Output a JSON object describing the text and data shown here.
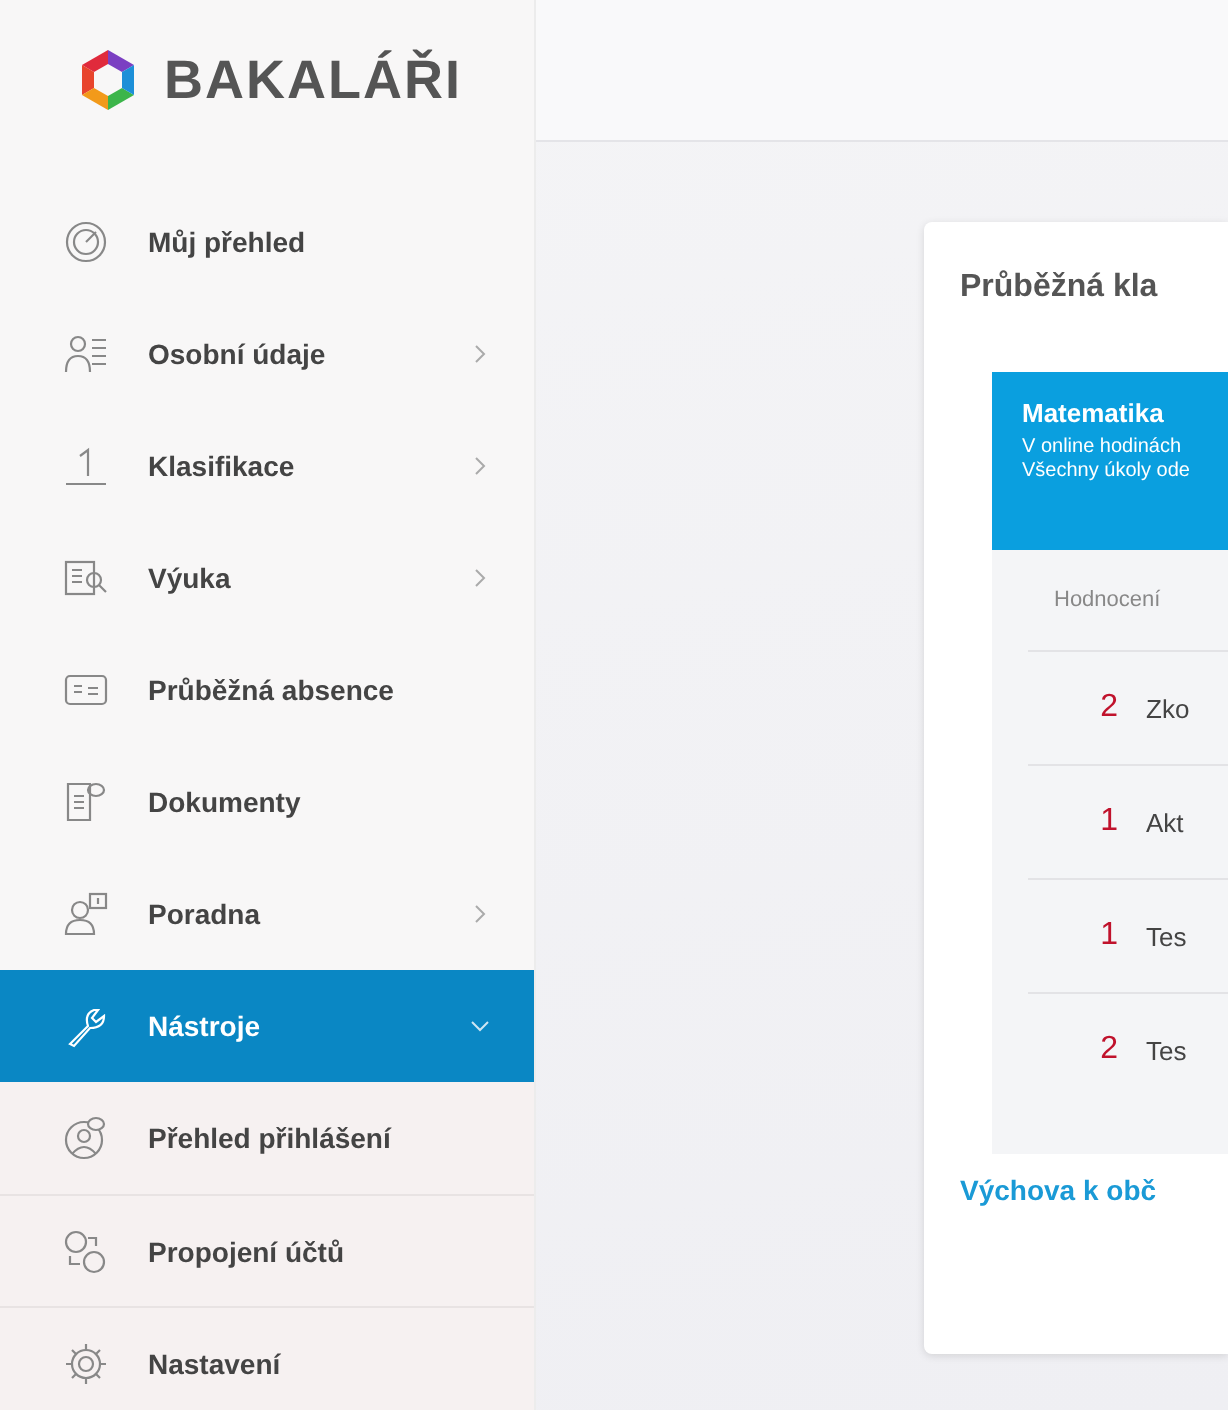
{
  "logo": {
    "text": "BAKALÁŘI"
  },
  "sidebar": {
    "items": [
      {
        "label": "Můj přehled",
        "kind": "link",
        "selected": false
      },
      {
        "label": "Osobní údaje",
        "kind": "group",
        "expanded": false,
        "selected": false
      },
      {
        "label": "Klasifikace",
        "kind": "group",
        "expanded": false,
        "selected": false
      },
      {
        "label": "Výuka",
        "kind": "group",
        "expanded": false,
        "selected": false
      },
      {
        "label": "Průběžná absence",
        "kind": "link",
        "selected": false
      },
      {
        "label": "Dokumenty",
        "kind": "link",
        "selected": false
      },
      {
        "label": "Poradna",
        "kind": "group",
        "expanded": false,
        "selected": false
      },
      {
        "label": "Nástroje",
        "kind": "group",
        "expanded": true,
        "selected": true
      },
      {
        "label": "Přehled přihlášení",
        "kind": "subitem",
        "selected": false
      },
      {
        "label": "Propojení účtů",
        "kind": "subitem",
        "selected": false
      },
      {
        "label": "Nastavení",
        "kind": "subitem",
        "selected": false
      }
    ]
  },
  "card": {
    "title": "Průběžná kla",
    "subjects": [
      {
        "name": "Matematika",
        "notes": [
          "V online hodinách",
          "Všechny úkoly ode"
        ],
        "column_header": "Hodnocení",
        "rows": [
          {
            "grade": "2",
            "text": "Zko"
          },
          {
            "grade": "1",
            "text": "Akt"
          },
          {
            "grade": "1",
            "text": "Tes"
          },
          {
            "grade": "2",
            "text": "Tes"
          }
        ]
      }
    ],
    "next_subject": "Výchova k obč"
  }
}
